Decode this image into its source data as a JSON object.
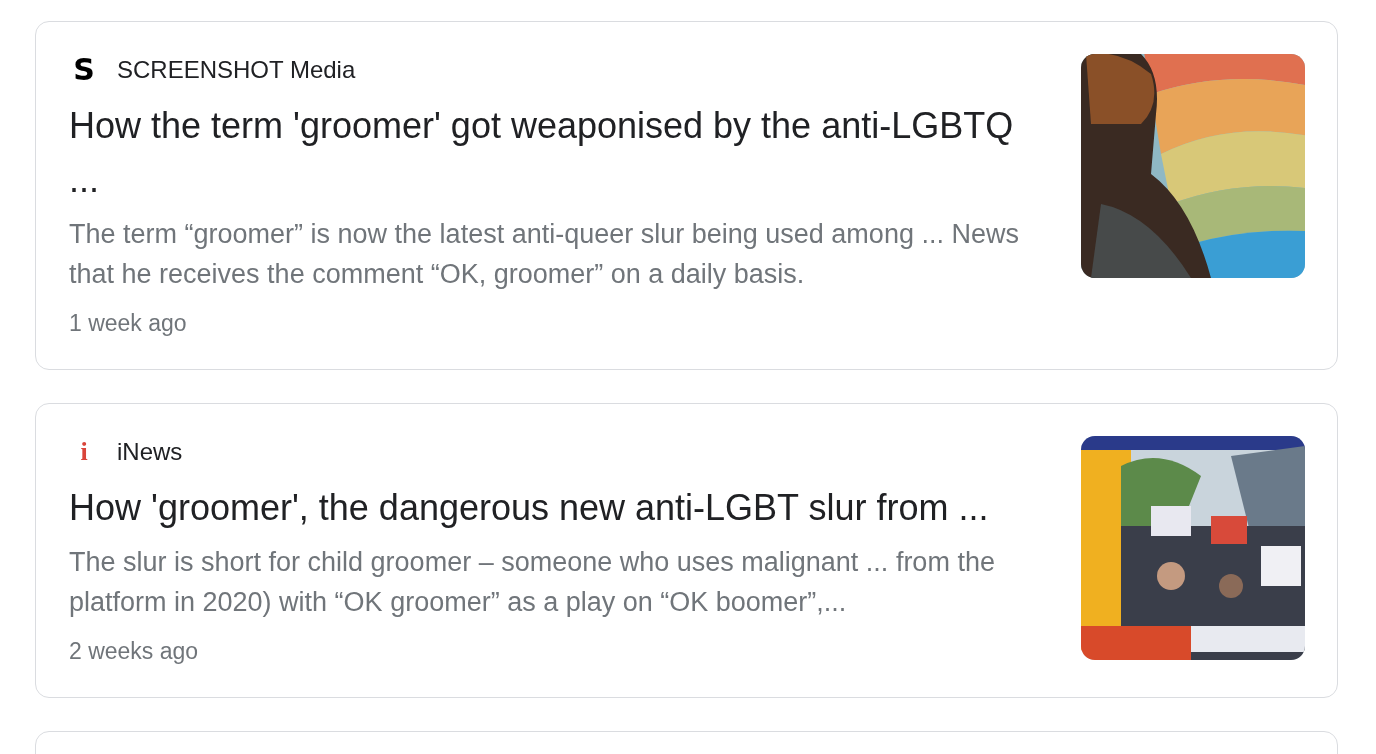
{
  "results": [
    {
      "source": {
        "logo_text": "S",
        "name": "SCREENSHOT Media"
      },
      "title": "How the term 'groomer' got weaponised by the anti-LGBTQ ...",
      "snippet": "The term “groomer” is now the latest anti-queer slur being used among ... News that he receives the comment “OK, groomer” on a daily basis.",
      "time": "1 week ago"
    },
    {
      "source": {
        "logo_text": "i",
        "name": "iNews"
      },
      "title": "How 'groomer', the dangerous new anti-LGBT slur from ...",
      "snippet": "The slur is short for child groomer – someone who uses malignant ... from the platform in 2020) with “OK groomer” as a play on “OK boomer”,...",
      "time": "2 weeks ago"
    }
  ]
}
